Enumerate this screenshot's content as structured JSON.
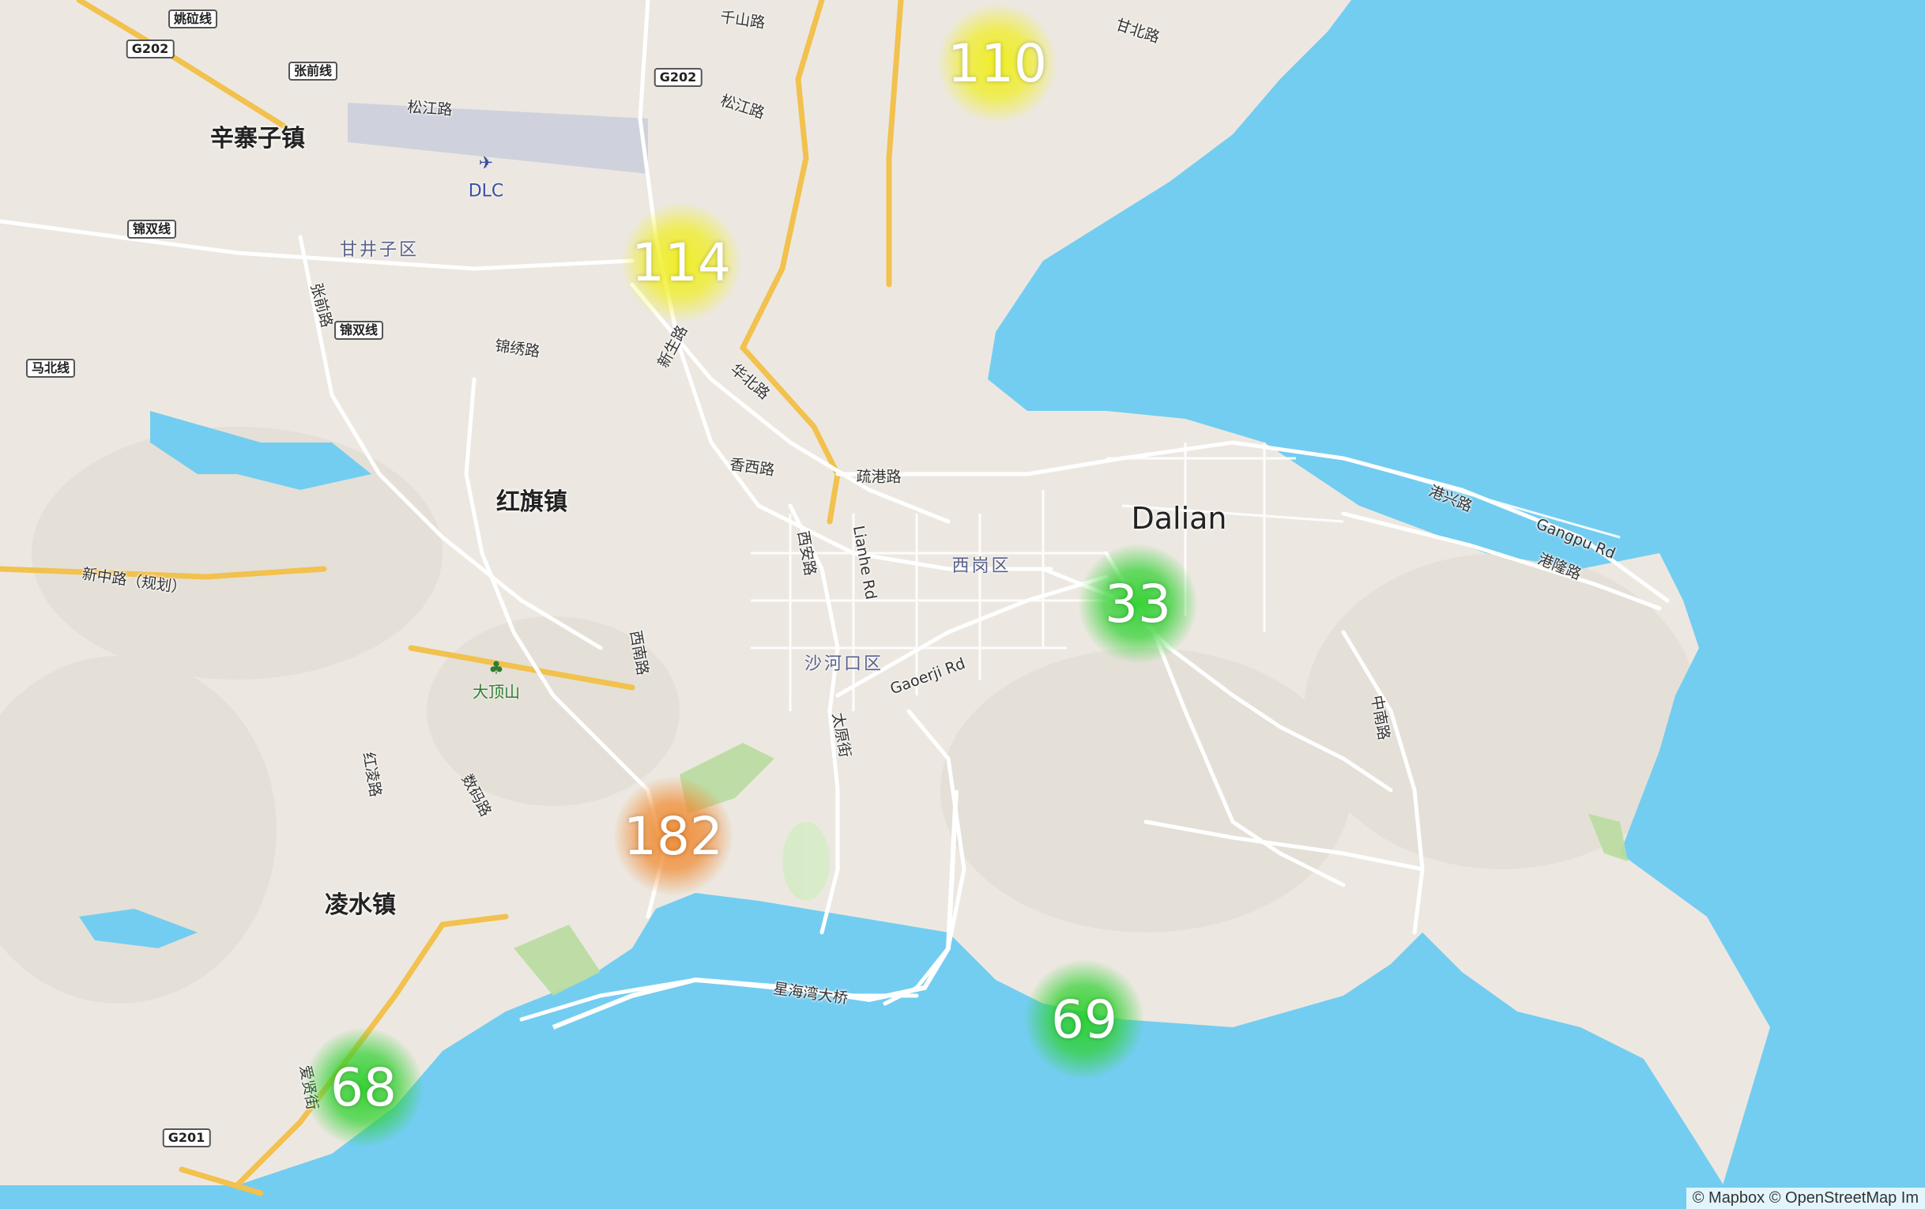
{
  "map": {
    "city_label": "Dalian",
    "airport_code": "DLC",
    "attribution": "© Mapbox © OpenStreetMap  Im",
    "colors": {
      "water": "#73cdf0",
      "land": "#ece8e1",
      "road_major": "#f2c14e",
      "road_minor": "#ffffff",
      "park": "#b9dca0",
      "cluster_green": "#2ed12e",
      "cluster_yellow": "#f0ee1e",
      "cluster_orange": "#f0892e"
    }
  },
  "clusters": [
    {
      "count": "110",
      "level": "yellow"
    },
    {
      "count": "114",
      "level": "yellow"
    },
    {
      "count": "33",
      "level": "green"
    },
    {
      "count": "182",
      "level": "orange"
    },
    {
      "count": "69",
      "level": "green"
    },
    {
      "count": "68",
      "level": "green"
    }
  ],
  "labels": {
    "towns": [
      "辛寨子镇",
      "红旗镇",
      "凌水镇"
    ],
    "districts": [
      "甘井子区",
      "西岗区",
      "沙河口区"
    ],
    "park": "大顶山",
    "roads": [
      "千山路",
      "甘北路",
      "松江路",
      "松江路",
      "锦绣路",
      "新生路",
      "华北路",
      "香西路",
      "疏港路",
      "西安路",
      "Lianhe Rd",
      "西南路",
      "Gaoerji Rd",
      "太原街",
      "港兴路",
      "Gangpu Rd",
      "港隆路",
      "中南路",
      "新中路（规划）",
      "红凌路",
      "数码路",
      "爱贤街",
      "星海湾大桥",
      "张前路"
    ]
  },
  "shields": [
    "姚砬线",
    "G202",
    "张前线",
    "G202",
    "锦双线",
    "锦双线",
    "马北线",
    "G201"
  ]
}
